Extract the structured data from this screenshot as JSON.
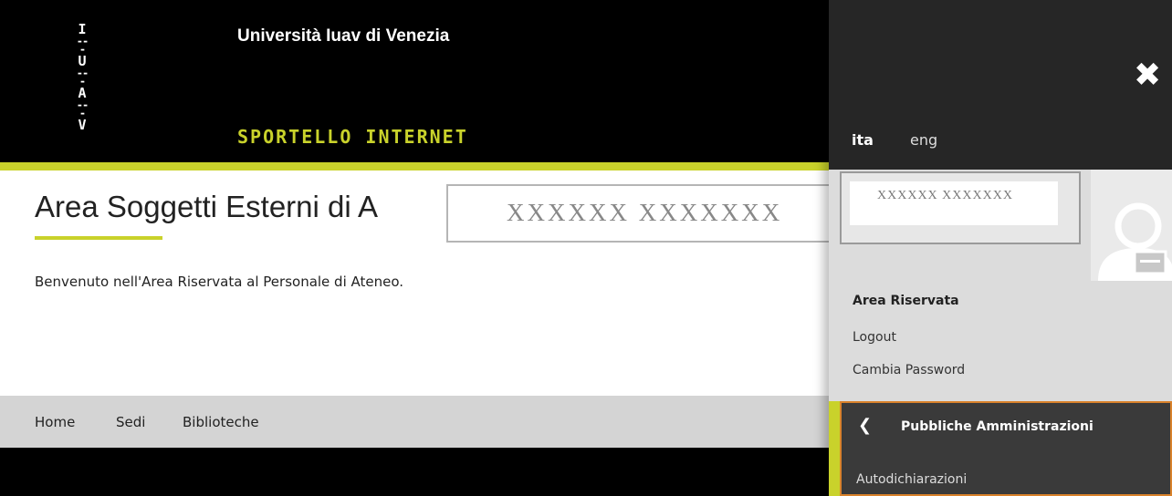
{
  "header": {
    "logo_letters": [
      "I",
      "U",
      "A",
      "V"
    ],
    "logo_separator": "---",
    "university": "Università Iuav di Venezia",
    "subtitle": "SPORTELLO INTERNET"
  },
  "main": {
    "title": "Area Soggetti Esterni di A",
    "redacted_name": "XXXXXX XXXXXXX",
    "welcome": "Benvenuto nell'Area Riservata al Personale di Ateneo."
  },
  "nav": {
    "items": [
      "Home",
      "Sedi",
      "Biblioteche"
    ]
  },
  "sidebar": {
    "close_icon": "close-icon",
    "lang_active": "ita",
    "lang_other": "eng",
    "user_name": "XXXXXX XXXXXXX",
    "section_title": "Area Riservata",
    "logout": "Logout",
    "change_password": "Cambia Password",
    "submenu_title": "Pubbliche Amministrazioni",
    "submenu_item": "Autodichiarazioni"
  },
  "colors": {
    "accent": "#c9d22b",
    "highlight": "#d9822b"
  }
}
